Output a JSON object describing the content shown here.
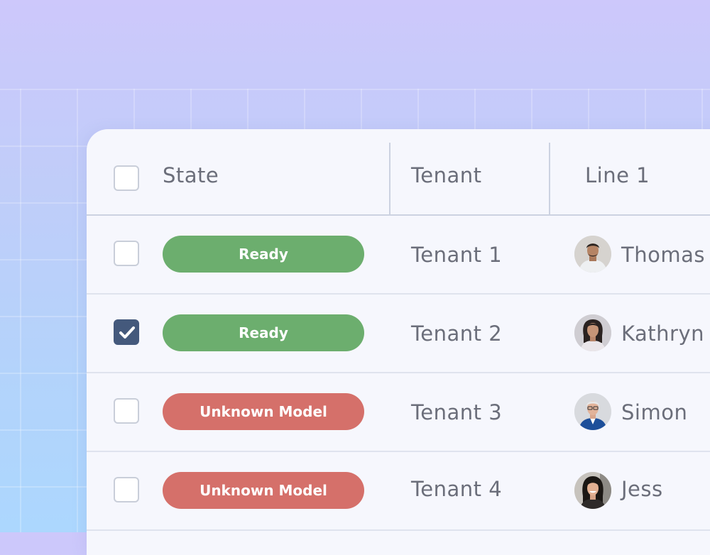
{
  "table": {
    "headers": {
      "state": "State",
      "tenant": "Tenant",
      "line1": "Line 1"
    },
    "rows": [
      {
        "state": "Ready",
        "state_color": "#6cae6e",
        "tenant": "Tenant 1",
        "user": "Thomas",
        "avatar": "man-avatar-icon",
        "checked": false
      },
      {
        "state": "Ready",
        "state_color": "#6cae6e",
        "tenant": "Tenant 2",
        "user": "Kathryn",
        "avatar": "woman-avatar-icon",
        "checked": true
      },
      {
        "state": "Unknown Model",
        "state_color": "#d5706a",
        "tenant": "Tenant 3",
        "user": "Simon",
        "avatar": "older-man-avatar-icon",
        "checked": false
      },
      {
        "state": "Unknown Model",
        "state_color": "#d5706a",
        "tenant": "Tenant 4",
        "user": "Jess",
        "avatar": "young-woman-avatar-icon",
        "checked": false
      }
    ]
  },
  "colors": {
    "ready": "#6cae6e",
    "unknown": "#d5706a",
    "checkbox_checked": "#44597c"
  }
}
